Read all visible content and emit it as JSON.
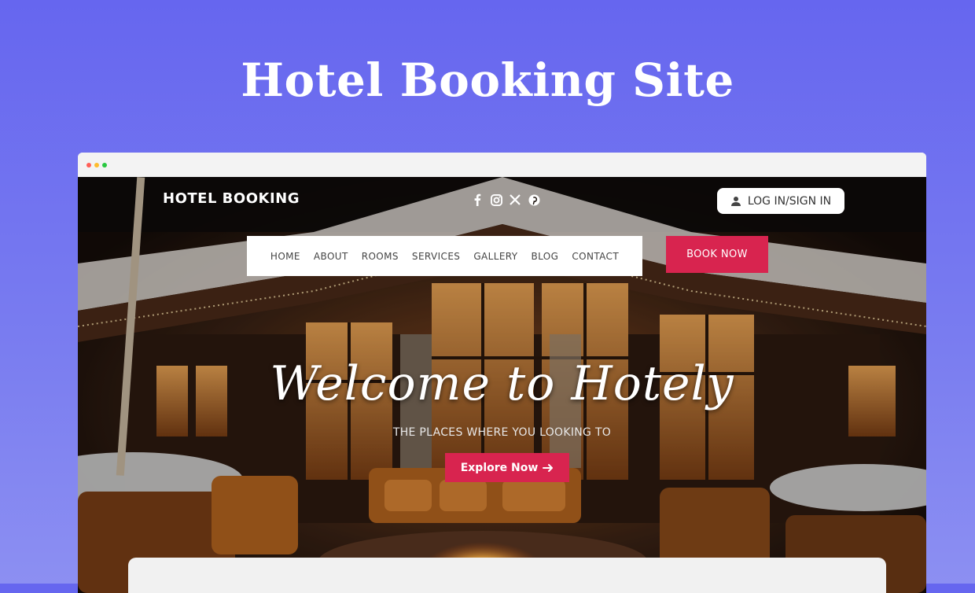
{
  "page": {
    "title": "Hotel Booking Site"
  },
  "site": {
    "brand": "HOTEL BOOKING",
    "socials": [
      {
        "name": "facebook-icon",
        "glyph": "f"
      },
      {
        "name": "instagram-icon",
        "glyph": ""
      },
      {
        "name": "x-icon",
        "glyph": "𝕏"
      },
      {
        "name": "pinterest-icon",
        "glyph": ""
      }
    ],
    "login_label": "LOG IN/SIGN IN",
    "nav": [
      "HOME",
      "ABOUT",
      "ROOMS",
      "SERVICES",
      "GALLERY",
      "BLOG",
      "CONTACT"
    ],
    "book_label": "BOOK NOW",
    "hero": {
      "heading": "Welcome to Hotely",
      "subheading": "THE PLACES WHERE YOU LOOKING TO",
      "cta_label": "Explore Now",
      "cta_icon": "arrow-right-icon"
    }
  },
  "colors": {
    "accent": "#d8244f",
    "background": "#6666ef"
  }
}
